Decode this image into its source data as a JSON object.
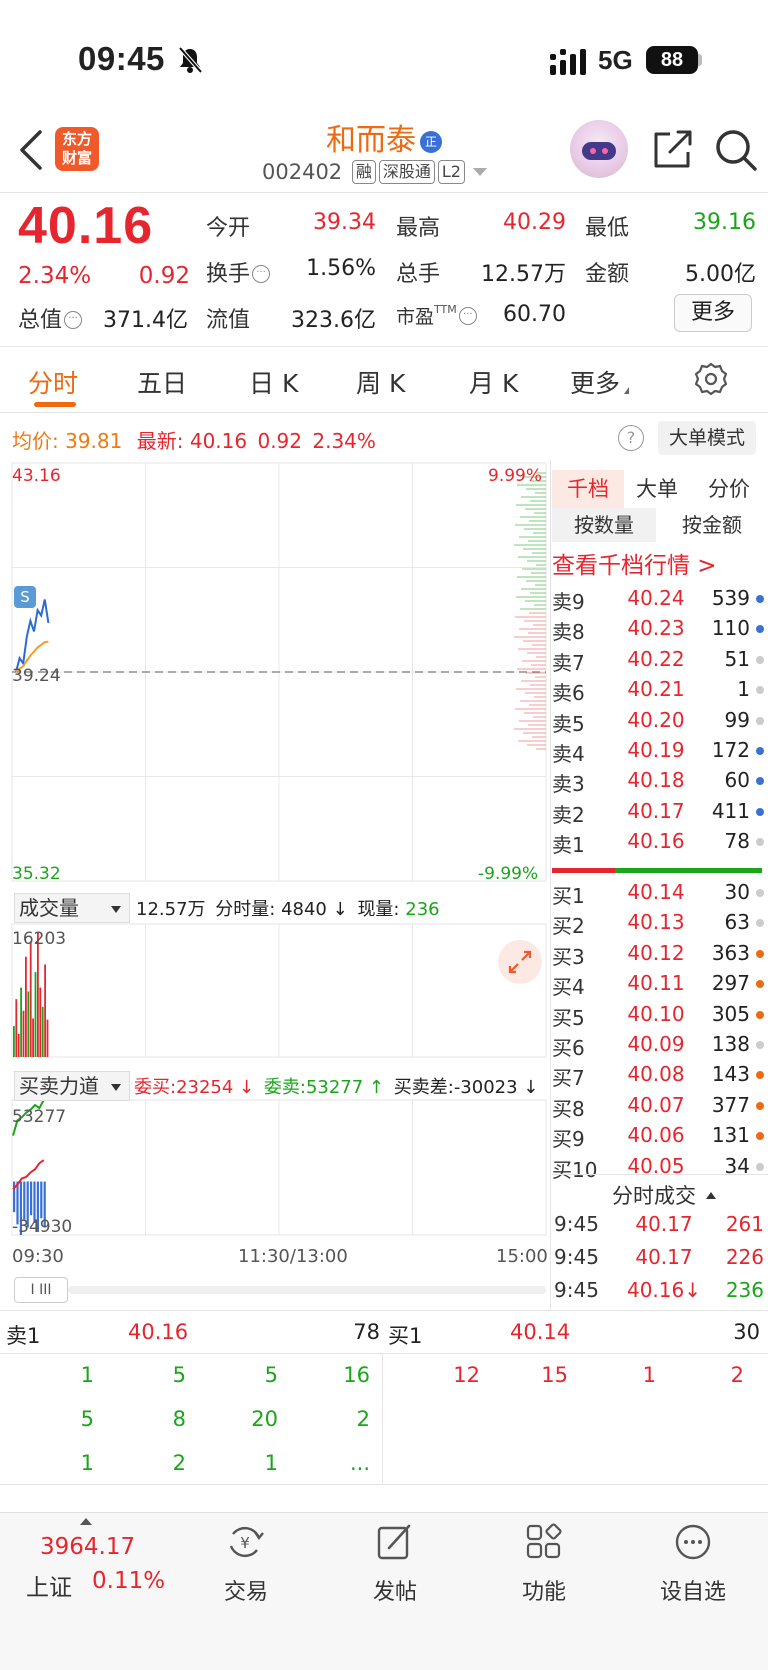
{
  "status_bar": {
    "time": "09:45",
    "network": "5G",
    "battery": "88"
  },
  "header": {
    "logo_line1": "东方",
    "logo_line2": "财富",
    "name": "和而泰",
    "name_badge": "正",
    "code": "002402",
    "tags": [
      "融",
      "深股通",
      "L2"
    ]
  },
  "quote": {
    "price": "40.16",
    "pct": "2.34%",
    "change": "0.92",
    "fields": [
      {
        "label": "今开",
        "value": "39.34"
      },
      {
        "label": "最高",
        "value": "40.29"
      },
      {
        "label": "最低",
        "value": "39.16"
      },
      {
        "label": "换手",
        "value": "1.56%"
      },
      {
        "label": "总手",
        "value": "12.57万"
      },
      {
        "label": "金额",
        "value": "5.00亿"
      },
      {
        "label": "总值",
        "value": "371.4亿"
      },
      {
        "label": "流值",
        "value": "323.6亿"
      },
      {
        "label": "市盈",
        "sup": "TTM",
        "value": "60.70"
      }
    ],
    "more_button": "更多"
  },
  "tabs": [
    "分时",
    "五日",
    "日 K",
    "周 K",
    "月 K",
    "更多"
  ],
  "intraday": {
    "avg_label": "均价:",
    "avg_value": "39.81",
    "latest_label": "最新:",
    "latest_price": "40.16",
    "latest_change": "0.92",
    "latest_pct": "2.34%",
    "help_icon": "?",
    "big_order_button": "大单模式",
    "price_top": "43.16",
    "price_mid": "39.24",
    "price_bottom": "35.32",
    "pct_top": "9.99%",
    "pct_bottom": "-9.99%",
    "marker": "S",
    "volume_select": "成交量",
    "volume_total": "12.57万",
    "minute_vol_label": "分时量:",
    "minute_vol": "4840 ↓",
    "current_vol_label": "现量:",
    "current_vol": "236",
    "volume_max": "16203",
    "force_select": "买卖力道",
    "bid_label": "委买:23254 ↓",
    "ask_label": "委卖:53277 ↑",
    "diff_label": "买卖差:-30023 ↓",
    "force_max": "53277",
    "force_min": "-34930",
    "time_start": "09:30",
    "time_mid": "11:30/13:00",
    "time_end": "15:00",
    "scroll_handle": "I III"
  },
  "chart_data": [
    {
      "type": "line",
      "title": "",
      "ylim": [
        35.32,
        43.16
      ],
      "pct_range": [
        "-9.99%",
        "9.99%"
      ],
      "prev_close": 39.24,
      "x_range": [
        "09:30",
        "15:00"
      ],
      "series": [
        {
          "values": [
            39.24,
            39.5,
            39.4,
            39.9,
            40.2,
            40.0,
            40.4,
            40.3,
            40.6,
            40.16
          ]
        },
        {
          "values": [
            39.24,
            39.3,
            39.35,
            39.45,
            39.55,
            39.62,
            39.7,
            39.75,
            39.8,
            39.81
          ]
        }
      ]
    },
    {
      "type": "bar",
      "title": "",
      "ylim": [
        0,
        16203
      ],
      "values": [
        4000,
        7500,
        3000,
        9000,
        6000,
        13000,
        8500,
        15000,
        5000,
        11000,
        16203,
        9000,
        6500,
        12000,
        4840
      ]
    },
    {
      "type": "line",
      "title": "",
      "ylim": [
        -34930,
        53277
      ],
      "series": [
        {
          "values": [
            30000,
            40000,
            42000,
            45000,
            47000,
            50000,
            48000,
            53277
          ]
        },
        {
          "values": [
            -5000,
            -2000,
            2000,
            3000,
            6000,
            8000,
            12000,
            14000
          ]
        }
      ],
      "bars": [
        -20000,
        -28000,
        -34930,
        -25000,
        -30000,
        -22000,
        -27000,
        -33000,
        -24000,
        -30023
      ]
    }
  ],
  "orderbook": {
    "tabs": [
      "千档",
      "大单",
      "分价"
    ],
    "sub_tabs": [
      "按数量",
      "按金额"
    ],
    "link": "查看千档行情 >",
    "asks": [
      {
        "label": "卖9",
        "price": "40.24",
        "vol": "539",
        "dot": "#3a70d6"
      },
      {
        "label": "卖8",
        "price": "40.23",
        "vol": "110",
        "dot": "#3a70d6"
      },
      {
        "label": "卖7",
        "price": "40.22",
        "vol": "51",
        "dot": "#cccccc"
      },
      {
        "label": "卖6",
        "price": "40.21",
        "vol": "1",
        "dot": "#cccccc"
      },
      {
        "label": "卖5",
        "price": "40.20",
        "vol": "99",
        "dot": "#cccccc"
      },
      {
        "label": "卖4",
        "price": "40.19",
        "vol": "172",
        "dot": "#3a70d6"
      },
      {
        "label": "卖3",
        "price": "40.18",
        "vol": "60",
        "dot": "#3a70d6"
      },
      {
        "label": "卖2",
        "price": "40.17",
        "vol": "411",
        "dot": "#3a70d6"
      },
      {
        "label": "卖1",
        "price": "40.16",
        "vol": "78",
        "dot": "#cccccc"
      }
    ],
    "bids": [
      {
        "label": "买1",
        "price": "40.14",
        "vol": "30",
        "dot": "#cccccc"
      },
      {
        "label": "买2",
        "price": "40.13",
        "vol": "63",
        "dot": "#cccccc"
      },
      {
        "label": "买3",
        "price": "40.12",
        "vol": "363",
        "dot": "#ee6a12"
      },
      {
        "label": "买4",
        "price": "40.11",
        "vol": "297",
        "dot": "#ee6a12"
      },
      {
        "label": "买5",
        "price": "40.10",
        "vol": "305",
        "dot": "#ee6a12"
      },
      {
        "label": "买6",
        "price": "40.09",
        "vol": "138",
        "dot": "#cccccc"
      },
      {
        "label": "买7",
        "price": "40.08",
        "vol": "143",
        "dot": "#ee6a12"
      },
      {
        "label": "买8",
        "price": "40.07",
        "vol": "377",
        "dot": "#ee6a12"
      },
      {
        "label": "买9",
        "price": "40.06",
        "vol": "131",
        "dot": "#ee6a12"
      },
      {
        "label": "买10",
        "price": "40.05",
        "vol": "34",
        "dot": "#cccccc"
      }
    ],
    "trades_title": "分时成交",
    "trades": [
      {
        "time": "9:45",
        "price": "40.17",
        "vol": "261",
        "color": "#e6262f"
      },
      {
        "time": "9:45",
        "price": "40.17",
        "vol": "226",
        "color": "#e6262f"
      },
      {
        "time": "9:45",
        "price": "40.16↓",
        "vol": "236",
        "color": "#1aa51a"
      }
    ]
  },
  "depth": {
    "ask_label": "卖1",
    "ask_price": "40.16",
    "ask_vol": "78",
    "bid_label": "买1",
    "bid_price": "40.14",
    "bid_vol": "30",
    "ask_queue": [
      "1",
      "5",
      "5",
      "16",
      "5",
      "8",
      "20",
      "2",
      "1",
      "2",
      "1",
      "..."
    ],
    "bid_queue": [
      "12",
      "15",
      "1",
      "2"
    ]
  },
  "bottom_nav": {
    "index_value": "3964.17",
    "index_name": "上证",
    "index_pct": "0.11%",
    "items": [
      "交易",
      "发帖",
      "功能",
      "设自选"
    ]
  }
}
